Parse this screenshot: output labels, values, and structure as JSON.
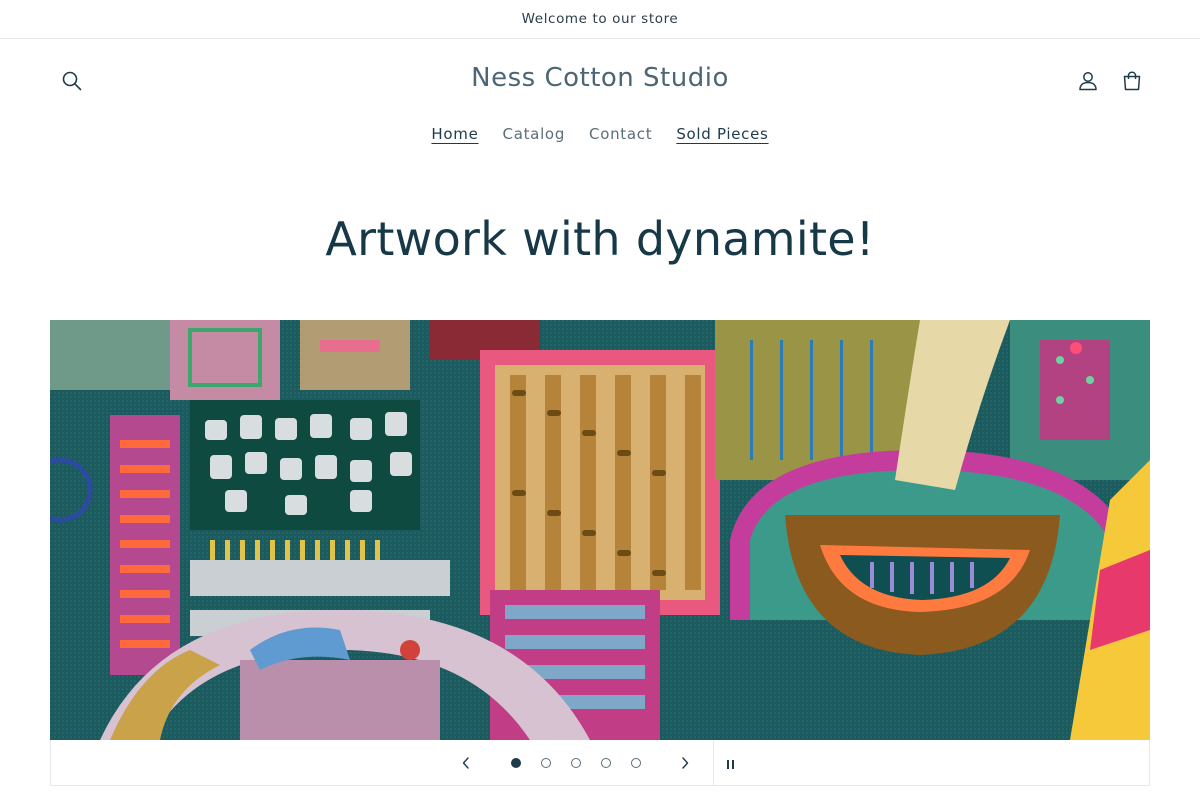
{
  "announcement": {
    "text": "Welcome to our store"
  },
  "header": {
    "logo": "Ness Cotton Studio",
    "icons": {
      "search": "search-icon",
      "account": "account-icon",
      "cart": "cart-icon"
    }
  },
  "nav": {
    "items": [
      {
        "label": "Home",
        "active": true
      },
      {
        "label": "Catalog",
        "active": false
      },
      {
        "label": "Contact",
        "active": false
      },
      {
        "label": "Sold Pieces",
        "active": false
      }
    ]
  },
  "hero": {
    "title": "Artwork with dynamite!"
  },
  "slideshow": {
    "slide_count": 5,
    "current_slide": 1,
    "image": "abstract painting with colorful striped rectangles, gold leaf and arches",
    "controls": {
      "prev": "chevron-left-icon",
      "next": "chevron-right-icon",
      "pause": "pause-icon"
    }
  },
  "colors": {
    "text": "#1d3b4a",
    "logo": "#4c6675",
    "border": "#e6e9eb",
    "painting_base": "#1c5a5e"
  }
}
